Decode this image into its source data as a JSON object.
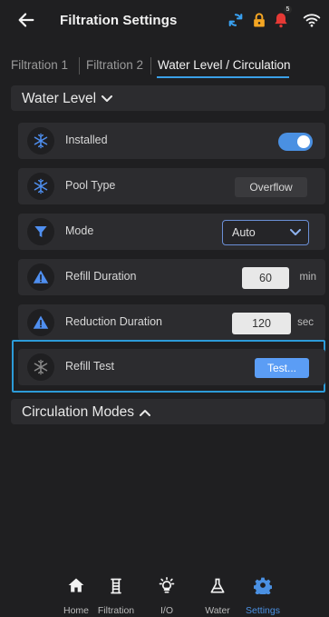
{
  "header": {
    "title": "Filtration Settings",
    "notification_count": "5"
  },
  "tabs": [
    {
      "label": "Filtration 1",
      "active": false
    },
    {
      "label": "Filtration 2",
      "active": false
    },
    {
      "label": "Water Level / Circulation",
      "active": true
    }
  ],
  "water_level": {
    "title": "Water Level",
    "rows": [
      {
        "label": "Installed",
        "icon": "snowflake-icon",
        "control": "toggle",
        "value": true
      },
      {
        "label": "Pool Type",
        "icon": "snowflake-icon",
        "control": "pill",
        "value": "Overflow"
      },
      {
        "label": "Mode",
        "icon": "filter-funnel-icon",
        "control": "select",
        "value": "Auto"
      },
      {
        "label": "Refill Duration",
        "icon": "warning-icon",
        "control": "number",
        "value": "60",
        "unit": "min"
      },
      {
        "label": "Reduction Duration",
        "icon": "warning-icon",
        "control": "number",
        "value": "120",
        "unit": "sec"
      },
      {
        "label": "Refill Test",
        "icon": "snowflake-icon",
        "control": "button",
        "value": "Test..."
      }
    ]
  },
  "circulation": {
    "title": "Circulation Modes"
  },
  "bottom_nav": [
    {
      "label": "Home",
      "icon": "home-icon",
      "active": false
    },
    {
      "label": "Filtration",
      "icon": "filtration-icon",
      "active": false
    },
    {
      "label": "I/O",
      "icon": "lightbulb-icon",
      "active": false
    },
    {
      "label": "Water",
      "icon": "flask-icon",
      "active": false
    },
    {
      "label": "Settings",
      "icon": "gear-icon",
      "active": true
    }
  ],
  "colors": {
    "background": "#1f1f21",
    "panel": "#2c2c2f",
    "accent": "#4a90e2",
    "highlight_border": "#2c9bd8",
    "alert_red": "#e53935",
    "lock_orange": "#f5a623"
  }
}
